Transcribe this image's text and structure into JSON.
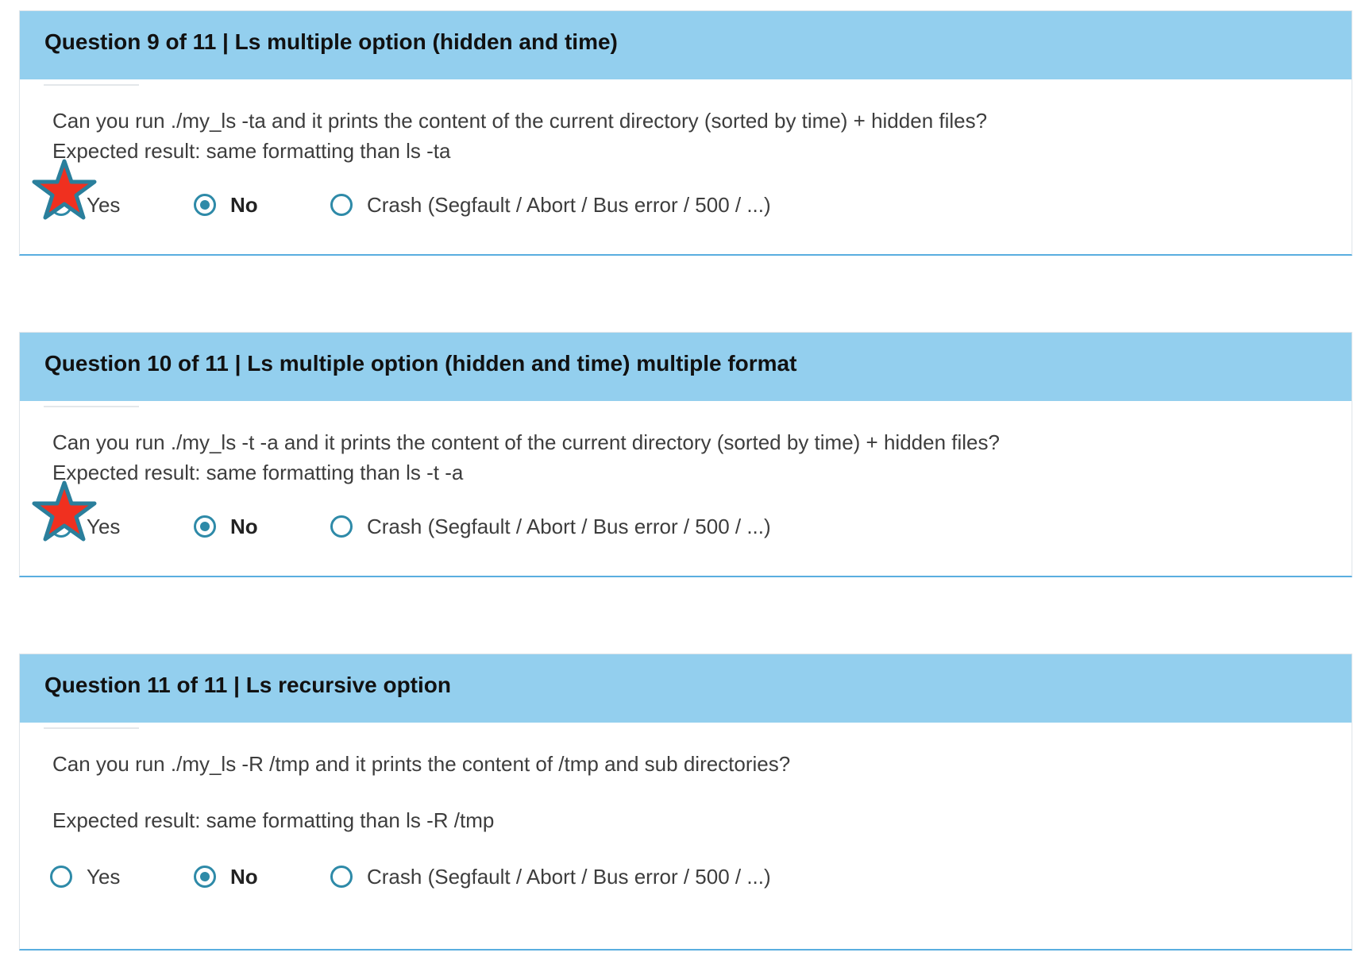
{
  "questions": [
    {
      "title": "Question 9 of 11 | Ls multiple option (hidden and time)",
      "text_lines": [
        "Can you run ./my_ls -ta and it prints the content of the current directory (sorted by time) + hidden files?",
        "Expected result: same formatting than ls -ta"
      ],
      "options": [
        "Yes",
        "No",
        "Crash (Segfault / Abort / Bus error / 500 / ...)"
      ],
      "selected": "No",
      "starred_option": "Yes"
    },
    {
      "title": "Question 10 of 11 | Ls multiple option (hidden and time) multiple format",
      "text_lines": [
        "Can you run ./my_ls -t -a and it prints the content of the current directory (sorted by time) + hidden files?",
        "Expected result: same formatting than ls -t -a"
      ],
      "options": [
        "Yes",
        "No",
        "Crash (Segfault / Abort / Bus error / 500 / ...)"
      ],
      "selected": "No",
      "starred_option": "Yes"
    },
    {
      "title": "Question 11 of 11 | Ls recursive option",
      "text_lines": [
        "Can you run ./my_ls -R /tmp and it prints the content of /tmp and sub directories?",
        "Expected result: same formatting than ls -R /tmp"
      ],
      "options": [
        "Yes",
        "No",
        "Crash (Segfault / Abort / Bus error / 500 / ...)"
      ],
      "selected": "No",
      "starred_option": ""
    }
  ],
  "colors": {
    "header_bg": "#93cfee",
    "radio_accent": "#2e8aa8",
    "card_bottom_border": "#5aaee0",
    "star_fill": "#f0301f",
    "star_outline": "#2a7f9c"
  },
  "icons": {
    "star": "star-icon",
    "radio": "radio-icon"
  }
}
